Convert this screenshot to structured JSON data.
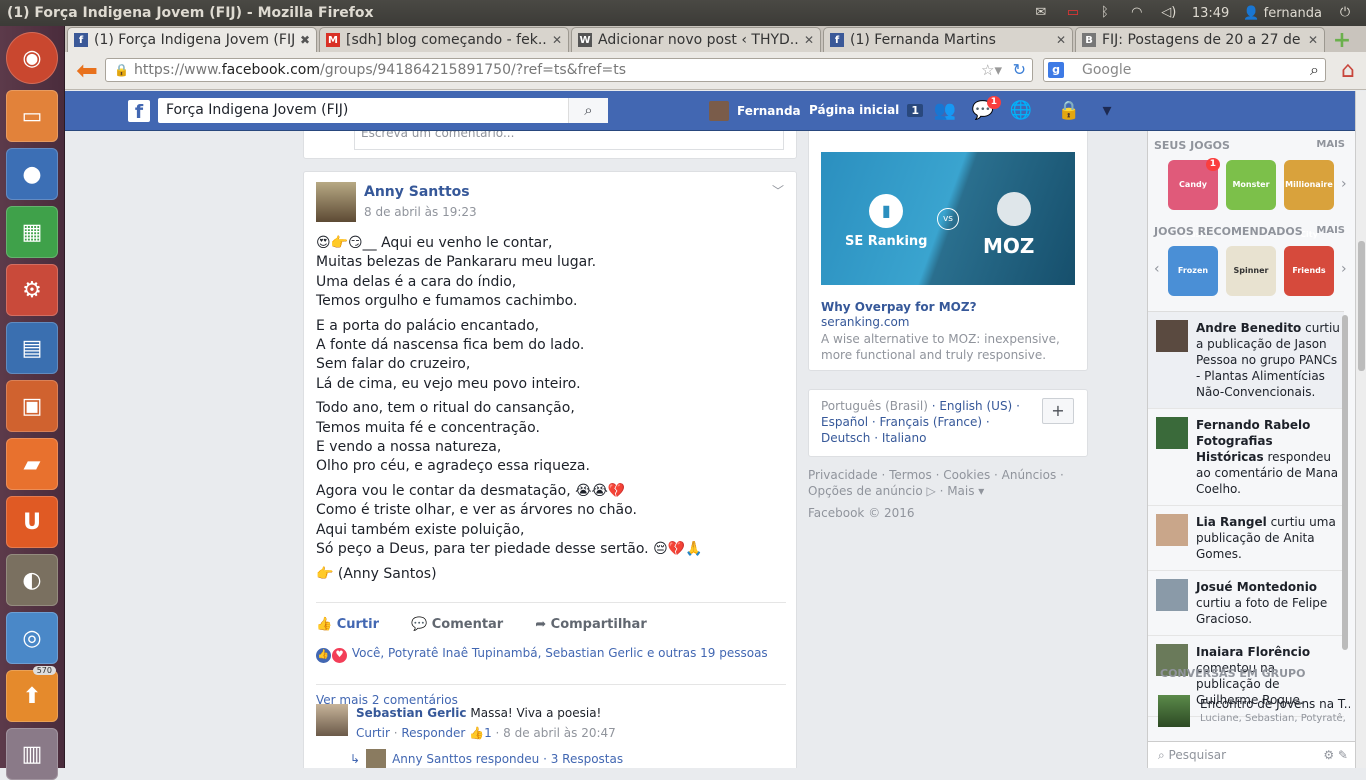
{
  "window": {
    "title": "(1) Força Indigena Jovem (FIJ) - Mozilla Firefox"
  },
  "tray": {
    "clock": "13:49",
    "user": "fernanda"
  },
  "launcher": {
    "badge": "570"
  },
  "tabs": [
    {
      "label": "(1) Força Indigena Jovem (FIJ)",
      "icon": "facebook-icon",
      "color": "#3b5998"
    },
    {
      "label": "[sdh] blog começando - fek...",
      "icon": "gmail-icon",
      "color": "#d93025"
    },
    {
      "label": "Adicionar novo post ‹ THYD...",
      "icon": "wordpress-icon",
      "color": "#555555"
    },
    {
      "label": "(1) Fernanda Martins",
      "icon": "facebook-icon",
      "color": "#3b5998"
    },
    {
      "label": "FIJ: Postagens de 20 a 27 de...",
      "icon": "blogger-icon",
      "color": "#777777"
    }
  ],
  "nav": {
    "url_prefix": "https://www.",
    "url_host": "facebook.com",
    "url_rest": "/groups/941864215891750/?ref=ts&fref=ts",
    "search_placeholder": "Google"
  },
  "fb": {
    "search_value": "Força Indigena Jovem (FIJ)",
    "user_name": "Fernanda",
    "home_label": "Página inicial",
    "home_count": "1",
    "messages_badge": "1"
  },
  "post": {
    "comment_placeholder": "Escreva um comentário...",
    "author": "Anny Santtos",
    "date": "8 de abril às 19:23",
    "stanzas": [
      [
        "😍👉😏__ Aqui eu venho le contar,",
        "Muitas belezas de Pankararu meu lugar.",
        "Uma delas é a cara do índio,",
        "Temos orgulho e fumamos cachimbo."
      ],
      [
        "E a porta do palácio encantado,",
        "A fonte dá nascensa fica bem do lado.",
        "Sem falar do cruzeiro,",
        "Lá de cima, eu vejo meu povo inteiro."
      ],
      [
        "Todo ano, tem o ritual do cansanção,",
        "Temos muita fé e concentração.",
        "E vendo a nossa natureza,",
        "Olho pro céu, e agradeço essa riqueza."
      ],
      [
        "Agora vou le contar da desmatação, 😭😭💔",
        "Como é triste olhar, e ver as árvores no chão.",
        "Aqui também existe poluição,",
        "Só peço a Deus, para ter piedade desse sertão. 😔💔🙏"
      ],
      [
        "👉 (Anny Santos)"
      ]
    ],
    "actions": {
      "like": "Curtir",
      "comment": "Comentar",
      "share": "Compartilhar"
    },
    "reactions_text": "Você, Potyratê Inaê Tupinambá, Sebastian Gerlic e outras 19 pessoas",
    "more_comments": "Ver mais 2 comentários",
    "comment": {
      "author": "Sebastian Gerlic",
      "text": "Massa! Viva a poesia!",
      "like": "Curtir",
      "reply": "Responder",
      "likes": "1",
      "date": "8 de abril às 20:47"
    },
    "reply_summary": "Anny Santtos respondeu · 3 Respostas"
  },
  "ad": {
    "image_left": "SE Ranking",
    "image_vs": "vs",
    "image_right": "MOZ",
    "headline": "Why Overpay for MOZ?",
    "domain": "seranking.com",
    "text": "A wise alternative to MOZ: inexpensive, more functional and truly responsive."
  },
  "languages": {
    "current": "Português (Brasil)",
    "others": [
      "English (US)",
      "Español",
      "Français (France)",
      "Deutsch",
      "Italiano"
    ]
  },
  "footer": {
    "links": "Privacidade · Termos · Cookies · Anúncios · Opções de anúncio ▷ · Mais ▾",
    "copyright": "Facebook © 2016"
  },
  "rightcol": {
    "games_title": "SEUS JOGOS",
    "more": "MAIS",
    "rec_title": "JOGOS RECOMENDADOS",
    "games": [
      {
        "label": "Candy Crush",
        "badge": "1",
        "color": "#e05a7a"
      },
      {
        "label": "Monster",
        "badge": "",
        "color": "#7cc04a"
      },
      {
        "label": "Millionaire City",
        "badge": "",
        "color": "#d9a23c"
      }
    ],
    "rec_games": [
      {
        "label": "Frozen",
        "color": "#4a8fd6"
      },
      {
        "label": "Spinner",
        "color": "#e8e2d0"
      },
      {
        "label": "Friends",
        "color": "#d64a3c"
      }
    ],
    "ticker": [
      {
        "name": "Andre Benedito",
        "text": " curtiu a publicação de Jason Pessoa no grupo PANCs - Plantas Alimentícias Não-Convencionais."
      },
      {
        "name": "Fernando Rabelo Fotografias Históricas",
        "text": " respondeu ao comentário de Mana Coelho."
      },
      {
        "name": "Lia Rangel",
        "text": " curtiu uma publicação de Anita Gomes."
      },
      {
        "name": "Josué Montedonio",
        "text": " curtiu a foto de Felipe Gracioso."
      },
      {
        "name": "Inaiara Florêncio",
        "text": " comentou na publicação de Guilherme Roque."
      }
    ],
    "conv_title": "CONVERSAS EM GRUPO",
    "conv_name": "Encontro de Jovens na T...",
    "conv_members": "Luciane, Sebastian, Potyratê, ...",
    "chat_search": "Pesquisar"
  }
}
